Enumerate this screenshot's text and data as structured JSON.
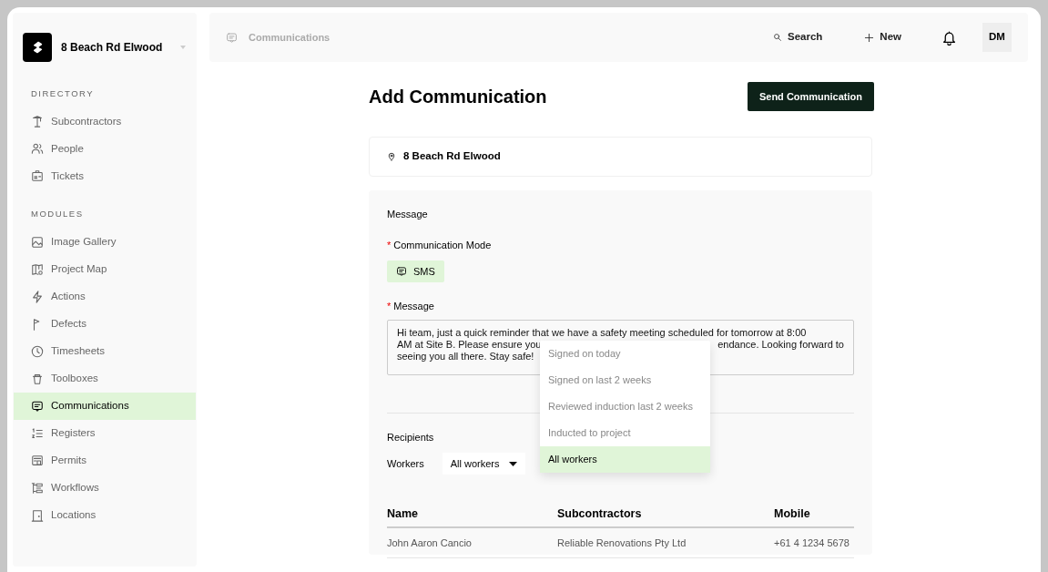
{
  "project": {
    "name": "8 Beach Rd Elwood"
  },
  "sidebar": {
    "sections": [
      {
        "heading": "DIRECTORY",
        "items": [
          {
            "label": "Subcontractors",
            "selected": false
          },
          {
            "label": "People",
            "selected": false
          },
          {
            "label": "Tickets",
            "selected": false
          }
        ]
      },
      {
        "heading": "MODULES",
        "items": [
          {
            "label": "Image Gallery",
            "selected": false
          },
          {
            "label": "Project Map",
            "selected": false
          },
          {
            "label": "Actions",
            "selected": false
          },
          {
            "label": "Defects",
            "selected": false
          },
          {
            "label": "Timesheets",
            "selected": false
          },
          {
            "label": "Toolboxes",
            "selected": false
          },
          {
            "label": "Communications",
            "selected": true
          },
          {
            "label": "Registers",
            "selected": false
          },
          {
            "label": "Permits",
            "selected": false
          },
          {
            "label": "Workflows",
            "selected": false
          },
          {
            "label": "Locations",
            "selected": false
          }
        ]
      }
    ]
  },
  "header": {
    "breadcrumb": "Communications",
    "search": "Search",
    "new": "New",
    "avatar": "DM"
  },
  "page": {
    "title": "Add Communication",
    "send_button": "Send Communication",
    "location": "8 Beach Rd Elwood"
  },
  "form": {
    "section": "Message",
    "mode_label": {
      "text": "Communication Mode",
      "required_mark": "*"
    },
    "mode": "SMS",
    "message_label": {
      "text": "Message",
      "required_mark": "*"
    },
    "message_lines": [
      [
        "Hi team, just a quick reminder that we have a safety meeting scheduled for tomorrow at 8:00"
      ],
      [
        "AM at Site B. Please ensure you",
        "endance. Looking forward to"
      ],
      [
        "seeing you all there. Stay safe!"
      ]
    ],
    "recipients": "Recipients",
    "workers_label": "Workers",
    "workers_value": "All workers"
  },
  "dropdown": [
    {
      "label": "Signed on today",
      "selected": false
    },
    {
      "label": "Signed on last 2 weeks",
      "selected": false
    },
    {
      "label": "Reviewed induction last 2 weeks",
      "selected": false
    },
    {
      "label": "Inducted to project",
      "selected": false
    },
    {
      "label": "All workers",
      "selected": true
    }
  ],
  "table": {
    "columns": [
      "Name",
      "Subcontractors",
      "Mobile"
    ],
    "rows": [
      [
        "John Aaron Cancio",
        "Reliable Renovations Pty Ltd",
        "+61 4 1234 5678"
      ]
    ]
  }
}
